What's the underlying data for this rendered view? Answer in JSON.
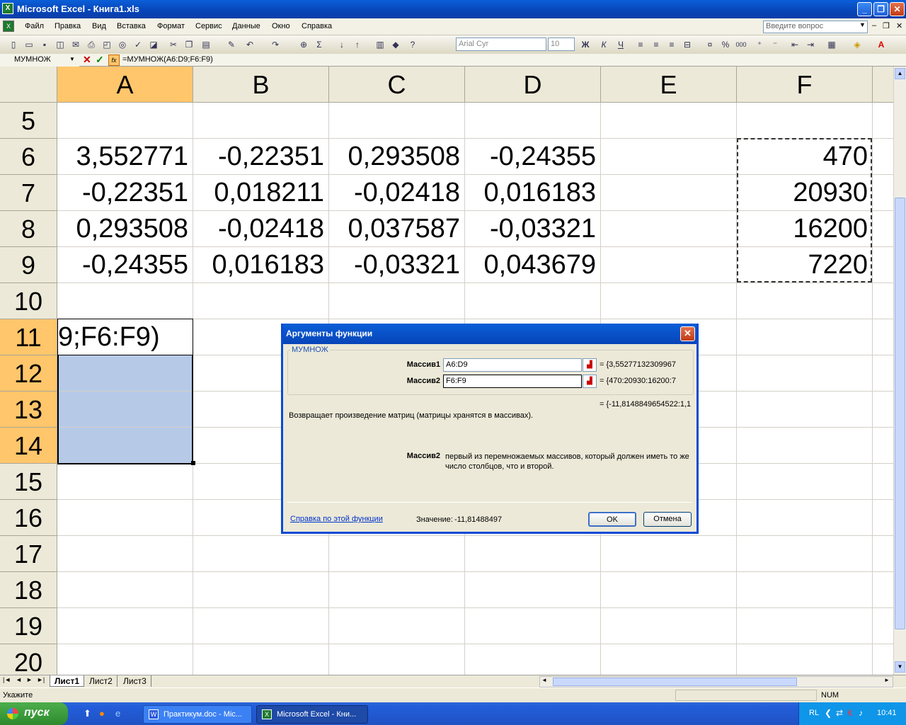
{
  "window": {
    "app_icon": "excel-icon",
    "title": "Microsoft Excel - Книга1.xls",
    "min": "_",
    "restore": "❐",
    "close": "✕"
  },
  "menu": {
    "items": [
      "Файл",
      "Правка",
      "Вид",
      "Вставка",
      "Формат",
      "Сервис",
      "Данные",
      "Окно",
      "Справка"
    ],
    "ask_placeholder": "Введите вопрос",
    "doc_controls": [
      "–",
      "❐",
      "✕"
    ]
  },
  "toolbar": {
    "font": "Arial Cyr",
    "size": "10",
    "bold": "Ж",
    "italic": "К",
    "underline": "Ч",
    "percent": "%",
    "thousands": "000"
  },
  "formula_bar": {
    "name_box": "МУМНОЖ",
    "cancel": "✕",
    "enter": "✓",
    "fx": "fx",
    "formula": "=МУМНОЖ(A6:D9;F6:F9)"
  },
  "grid": {
    "columns": [
      "A",
      "B",
      "C",
      "D",
      "E",
      "F"
    ],
    "rows": [
      "5",
      "6",
      "7",
      "8",
      "9",
      "10",
      "11",
      "12",
      "13",
      "14",
      "15",
      "16",
      "17",
      "18",
      "19",
      "20"
    ],
    "cells": {
      "A6": "3,552771",
      "B6": "-0,22351",
      "C6": "0,293508",
      "D6": "-0,24355",
      "F6": "470",
      "A7": "-0,22351",
      "B7": "0,018211",
      "C7": "-0,02418",
      "D7": "0,016183",
      "F7": "20930",
      "A8": "0,293508",
      "B8": "-0,02418",
      "C8": "0,037587",
      "D8": "-0,03321",
      "F8": "16200",
      "A9": "-0,24355",
      "B9": "0,016183",
      "C9": "-0,03321",
      "D9": "0,043679",
      "F9": "7220",
      "A11": "9;F6:F9)"
    }
  },
  "sheets": {
    "tabs": [
      "Лист1",
      "Лист2",
      "Лист3"
    ],
    "active": "Лист1"
  },
  "status": {
    "text": "Укажите",
    "num": "NUM"
  },
  "dialog": {
    "title": "Аргументы функции",
    "function_name": "МУМНОЖ",
    "arg1_label": "Массив1",
    "arg1_value": "A6:D9",
    "arg1_result": "= {3,55277132309967",
    "arg2_label": "Массив2",
    "arg2_value": "F6:F9",
    "arg2_result": "= {470:20930:16200:7",
    "total_result": "= {-11,8148849654522:1,1",
    "description": "Возвращает произведение матриц (матрицы хранятся в массивах).",
    "arg_help_label": "Массив2",
    "arg_help_text": "первый из перемножаемых массивов, который должен иметь то же число столбцов, что и второй.",
    "help_link": "Справка по этой функции",
    "value_label": "Значение:",
    "value": "-11,81488497",
    "ok": "OK",
    "cancel": "Отмена"
  },
  "taskbar": {
    "start": "пуск",
    "tasks": [
      "Практикум.doc - Mic...",
      "Microsoft Excel - Кни..."
    ],
    "lang": "RL",
    "time": "10:41"
  }
}
